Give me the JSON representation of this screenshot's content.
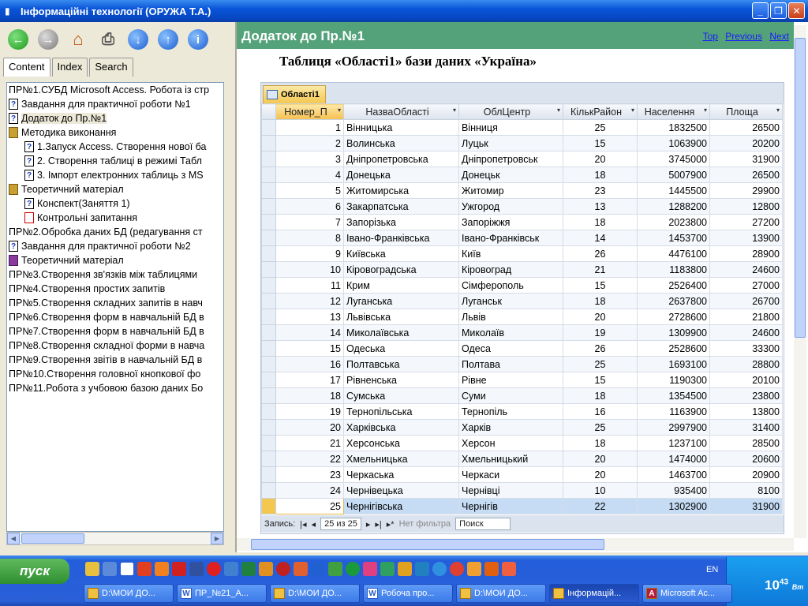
{
  "window": {
    "title": "Інформаційні технології (ОРУЖА Т.А.)"
  },
  "left_tabs": [
    "Content",
    "Index",
    "Search"
  ],
  "tree": [
    {
      "label": "ПР№1.СУБД Microsoft Access. Робота із стр",
      "icon": "none",
      "indent": 0
    },
    {
      "label": "Завдання для практичної роботи №1",
      "icon": "page",
      "indent": 0
    },
    {
      "label": "Додаток до Пр.№1",
      "icon": "page",
      "indent": 0,
      "selected": true
    },
    {
      "label": "Методика виконання",
      "icon": "book",
      "indent": 0
    },
    {
      "label": "1.Запуск Access. Створення нової ба",
      "icon": "page",
      "indent": 1
    },
    {
      "label": "2. Створення таблиці в режимі Табл",
      "icon": "page",
      "indent": 1
    },
    {
      "label": "3. Імпорт електронних таблиць з MS",
      "icon": "page",
      "indent": 1
    },
    {
      "label": "Теоретичний матеріал",
      "icon": "book",
      "indent": 0
    },
    {
      "label": "Конспект(Заняття 1)",
      "icon": "page",
      "indent": 1
    },
    {
      "label": "Контрольні запитання",
      "icon": "quiz",
      "indent": 1
    },
    {
      "label": "ПР№2.Обробка даних БД (редагування ст",
      "icon": "none",
      "indent": 0
    },
    {
      "label": "Завдання для практичної роботи №2",
      "icon": "page",
      "indent": 0
    },
    {
      "label": "Теоретичний матеріал",
      "icon": "book2",
      "indent": 0
    },
    {
      "label": "ПР№3.Створення зв'язків між таблицями",
      "icon": "none",
      "indent": 0
    },
    {
      "label": "ПР№4.Створення простих запитів",
      "icon": "none",
      "indent": 0
    },
    {
      "label": "ПР№5.Створення складних запитів в навч",
      "icon": "none",
      "indent": 0
    },
    {
      "label": "ПР№6.Створення форм в навчальній БД в",
      "icon": "none",
      "indent": 0
    },
    {
      "label": "ПР№7.Створення форм в навчальній БД в",
      "icon": "none",
      "indent": 0
    },
    {
      "label": "ПР№8.Створення складної форми в навча",
      "icon": "none",
      "indent": 0
    },
    {
      "label": "ПР№9.Створення звітів в навчальній БД в",
      "icon": "none",
      "indent": 0
    },
    {
      "label": "ПР№10.Створення головної кнопкової фо",
      "icon": "none",
      "indent": 0
    },
    {
      "label": "ПР№11.Робота з учбовою базою даних Бо",
      "icon": "none",
      "indent": 0
    }
  ],
  "header": {
    "title": "Додаток до Пр.№1",
    "links": [
      "Top",
      "Previous",
      "Next"
    ]
  },
  "caption": "Таблиця «Області1» бази даних «Україна»",
  "access": {
    "tab_label": "Області1",
    "columns": [
      "Номер_П",
      "НазваОбласті",
      "ОблЦентр",
      "КількРайон",
      "Населення",
      "Площа"
    ],
    "rows": [
      [
        "1",
        "Вінницька",
        "Вінниця",
        "25",
        "1832500",
        "26500"
      ],
      [
        "2",
        "Волинська",
        "Луцьк",
        "15",
        "1063900",
        "20200"
      ],
      [
        "3",
        "Дніпропетровська",
        "Дніпропетровськ",
        "20",
        "3745000",
        "31900"
      ],
      [
        "4",
        "Донецька",
        "Донецьк",
        "18",
        "5007900",
        "26500"
      ],
      [
        "5",
        "Житомирська",
        "Житомир",
        "23",
        "1445500",
        "29900"
      ],
      [
        "6",
        "Закарпатська",
        "Ужгород",
        "13",
        "1288200",
        "12800"
      ],
      [
        "7",
        "Запорізька",
        "Запоріжжя",
        "18",
        "2023800",
        "27200"
      ],
      [
        "8",
        "Івано-Франківська",
        "Івано-Франківськ",
        "14",
        "1453700",
        "13900"
      ],
      [
        "9",
        "Київська",
        "Київ",
        "26",
        "4476100",
        "28900"
      ],
      [
        "10",
        "Кіровоградська",
        "Кіровоград",
        "21",
        "1183800",
        "24600"
      ],
      [
        "11",
        "Крим",
        "Сімферополь",
        "15",
        "2526400",
        "27000"
      ],
      [
        "12",
        "Луганська",
        "Луганськ",
        "18",
        "2637800",
        "26700"
      ],
      [
        "13",
        "Львівська",
        "Львів",
        "20",
        "2728600",
        "21800"
      ],
      [
        "14",
        "Миколаївська",
        "Миколаїв",
        "19",
        "1309900",
        "24600"
      ],
      [
        "15",
        "Одеська",
        "Одеса",
        "26",
        "2528600",
        "33300"
      ],
      [
        "16",
        "Полтавська",
        "Полтава",
        "25",
        "1693100",
        "28800"
      ],
      [
        "17",
        "Рівненська",
        "Рівне",
        "15",
        "1190300",
        "20100"
      ],
      [
        "18",
        "Сумська",
        "Суми",
        "18",
        "1354500",
        "23800"
      ],
      [
        "19",
        "Тернопільська",
        "Тернопіль",
        "16",
        "1163900",
        "13800"
      ],
      [
        "20",
        "Харківська",
        "Харків",
        "25",
        "2997900",
        "31400"
      ],
      [
        "21",
        "Херсонська",
        "Херсон",
        "18",
        "1237100",
        "28500"
      ],
      [
        "22",
        "Хмельницька",
        "Хмельницький",
        "20",
        "1474000",
        "20600"
      ],
      [
        "23",
        "Черкаська",
        "Черкаси",
        "20",
        "1463700",
        "20900"
      ],
      [
        "24",
        "Чернівецька",
        "Чернівці",
        "10",
        "935400",
        "8100"
      ],
      [
        "25",
        "Чернігівська",
        "Чернігів",
        "22",
        "1302900",
        "31900"
      ]
    ],
    "nav": {
      "label": "Запись:",
      "position": "25 из 25",
      "filter": "Нет фильтра",
      "search": "Поиск"
    }
  },
  "taskbar": {
    "start": "пуск",
    "lang": "EN",
    "clock": "10",
    "clock_small": "43",
    "clock_day": "Вт",
    "buttons": [
      {
        "label": "D:\\МОИ ДО...",
        "icon": "folder"
      },
      {
        "label": "ПР_№21_А...",
        "icon": "word"
      },
      {
        "label": "D:\\МОИ ДО...",
        "icon": "folder"
      },
      {
        "label": "Робоча про...",
        "icon": "word"
      },
      {
        "label": "D:\\МОИ ДО...",
        "icon": "folder"
      },
      {
        "label": "Інформацій...",
        "icon": "help",
        "active": true
      },
      {
        "label": "Microsoft Ac...",
        "icon": "access"
      }
    ]
  }
}
